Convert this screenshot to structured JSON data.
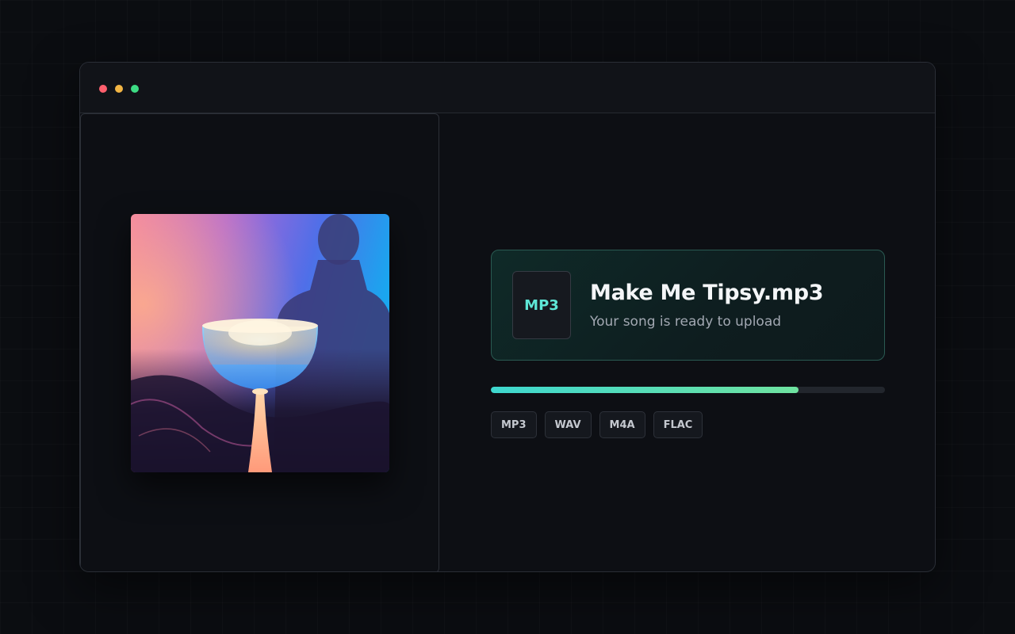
{
  "window": {
    "controls": [
      {
        "name": "close",
        "color": "#ff5f6d"
      },
      {
        "name": "minimize",
        "color": "#f2b544"
      },
      {
        "name": "maximize",
        "color": "#3ddc84"
      }
    ]
  },
  "file": {
    "type_label": "MP3",
    "name": "Make Me Tipsy.mp3",
    "status": "Your song is ready to upload"
  },
  "upload": {
    "progress": 0.78
  },
  "formats": [
    "MP3",
    "WAV",
    "M4A",
    "FLAC"
  ],
  "colors": {
    "accent": "#5ee6d6",
    "progress_start": "#3ed7cf",
    "progress_end": "#6fe3a0"
  }
}
